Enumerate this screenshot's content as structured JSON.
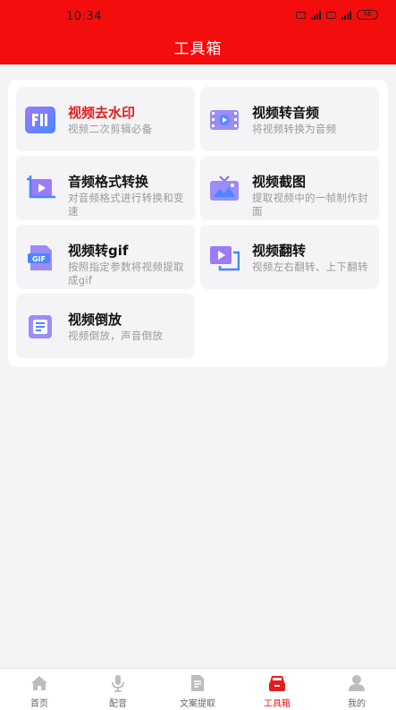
{
  "status_bar": {
    "time": "10:34",
    "battery": "56"
  },
  "header": {
    "title": "工具箱"
  },
  "tools": [
    {
      "title": "视频去水印",
      "desc": "视频二次剪辑必备",
      "icon": "watermark-icon"
    },
    {
      "title": "视频转音频",
      "desc": "将视频转换为音频",
      "icon": "film-audio-icon"
    },
    {
      "title": "音频格式转换",
      "desc": "对音频格式进行转换和变速",
      "icon": "crop-play-icon"
    },
    {
      "title": "视频截图",
      "desc": "提取视频中的一帧制作封面",
      "icon": "tv-picture-icon"
    },
    {
      "title": "视频转gif",
      "desc": "按照指定参数将视频提取成gif",
      "icon": "gif-file-icon"
    },
    {
      "title": "视频翻转",
      "desc": "视频左右翻转、上下翻转",
      "icon": "flip-video-icon"
    },
    {
      "title": "视频倒放",
      "desc": "视频倒放，声音倒放",
      "icon": "reverse-doc-icon"
    }
  ],
  "tabs": [
    {
      "label": "首页",
      "icon": "home-icon"
    },
    {
      "label": "配音",
      "icon": "microphone-icon"
    },
    {
      "label": "文案提取",
      "icon": "document-icon"
    },
    {
      "label": "工具箱",
      "icon": "toolbox-icon",
      "active": true
    },
    {
      "label": "我的",
      "icon": "user-icon"
    }
  ],
  "colors": {
    "primary": "#f40d0d",
    "accent_text": "#e61b1b",
    "icon_purple": "#7b6cf6",
    "icon_blue": "#4a86ff"
  }
}
